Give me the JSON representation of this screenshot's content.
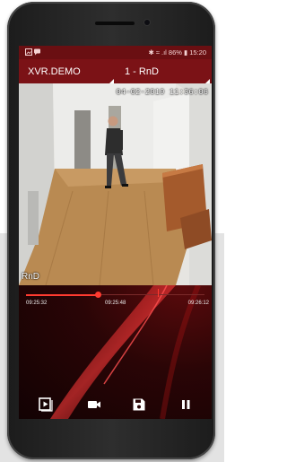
{
  "status_bar": {
    "notification_icons": [
      "image-icon",
      "chat-icon"
    ],
    "right_text": "✱ ≈ .ıl 86% ▮ 15:20"
  },
  "app_bar": {
    "device_name": "XVR.DEMO",
    "channel_name": "1 - RnD"
  },
  "video": {
    "timestamp": "04-02-2019 11:36:06",
    "camera_name": "RnD"
  },
  "timeline": {
    "start_time": "09:25:32",
    "current_time": "09:25:48",
    "end_time": "09:26:12",
    "progress": 0.4
  },
  "controls": {
    "icons": [
      "play-video-icon",
      "camera-icon",
      "save-icon",
      "pause-icon"
    ]
  },
  "colors": {
    "accent": "#7b1216",
    "playhead": "#ff3b30"
  }
}
